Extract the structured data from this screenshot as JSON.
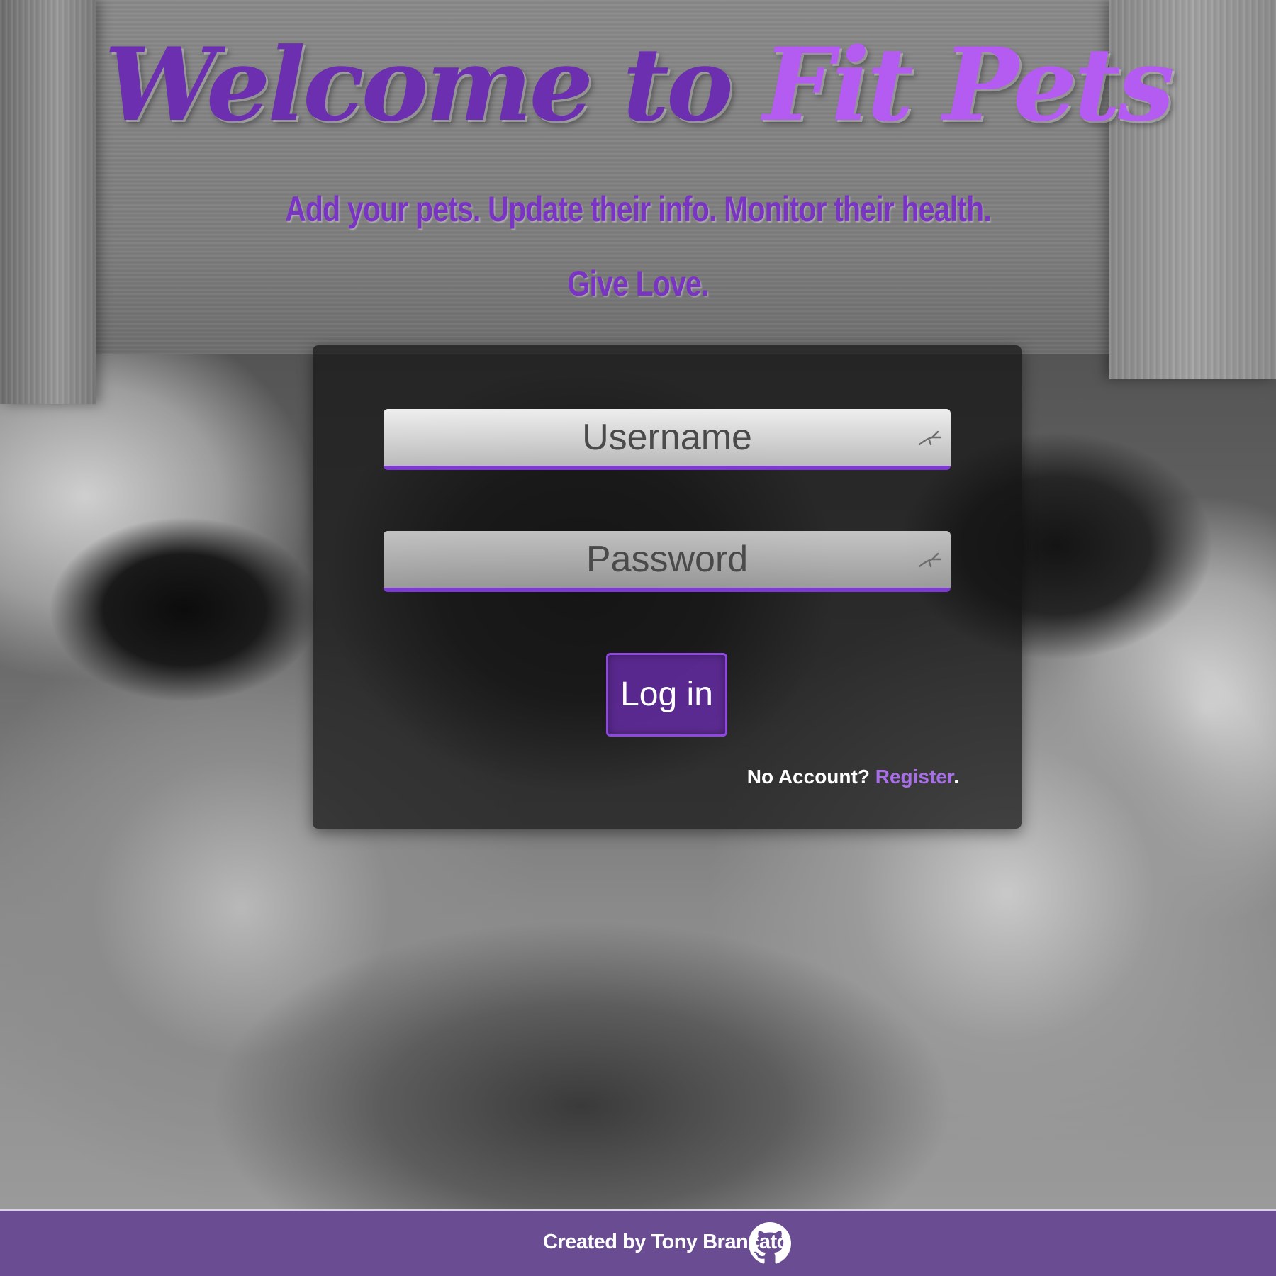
{
  "header": {
    "title_part1": "Welcome to ",
    "title_part2": "Fit Pets",
    "tagline_line1": "Add your pets. Update their info. Monitor their health.",
    "tagline_line2": "Give Love."
  },
  "login": {
    "username_placeholder": "Username",
    "username_value": "",
    "password_placeholder": "Password",
    "password_value": "",
    "submit_label": "Log in",
    "no_account_text": "No Account? ",
    "register_link": "Register",
    "register_suffix": "."
  },
  "footer": {
    "credit": "Created by Tony Brancato",
    "github_icon": "github-icon"
  },
  "colors": {
    "title_dark": "#6b2fb0",
    "title_light": "#b45cf2",
    "accent": "#7d3ad0",
    "footer_bg": "#6a4c92",
    "link": "#a86ee8"
  },
  "icons": {
    "field_corner": "autofill-key-icon",
    "footer": "github-icon"
  }
}
